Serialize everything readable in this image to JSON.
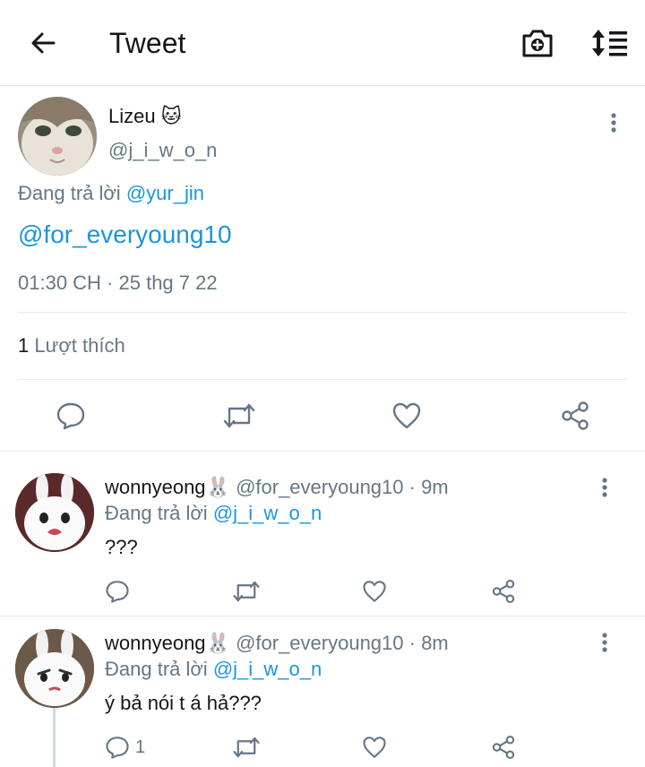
{
  "header": {
    "title": "Tweet",
    "back_icon": "arrow-left-icon",
    "camera_icon": "camera-plus-icon",
    "sort_icon": "sort-order-icon"
  },
  "main_tweet": {
    "name": "Lizeu 🐱",
    "handle": "@j_i_w_o_n",
    "reply_prefix": "Đang trả lời",
    "reply_mention": "@yur_jin",
    "text": "@for_everyoung10",
    "timestamp": "01:30 CH · 25 thg 7 22",
    "likes_count": "1",
    "likes_label": "Lượt thích",
    "actions": [
      "reply-icon",
      "retweet-icon",
      "like-icon",
      "share-icon"
    ]
  },
  "replies": [
    {
      "name": "wonnyeong🐰",
      "meta": "@for_everyoung10 · 9m",
      "reply_prefix": "Đang trả lời",
      "reply_mention": "@j_i_w_o_n",
      "text": "???",
      "reply_count": ""
    },
    {
      "name": "wonnyeong🐰",
      "meta": "@for_everyoung10 · 8m",
      "reply_prefix": "Đang trả lời",
      "reply_mention": "@j_i_w_o_n",
      "text": "ý bả nói t á hả???",
      "reply_count": "1"
    }
  ],
  "colors": {
    "link": "#1b95e0",
    "secondary_text": "#657786",
    "icon": "#657786",
    "divider": "#e1e8ed"
  }
}
